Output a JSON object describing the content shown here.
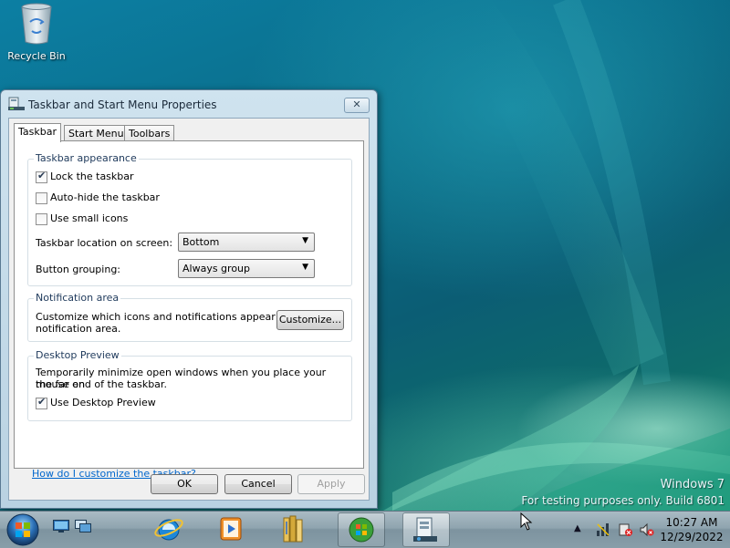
{
  "desktop": {
    "recycle_bin_label": "Recycle Bin",
    "watermark_line1": "Windows 7",
    "watermark_line2": "For testing purposes only. Build 6801"
  },
  "dialog": {
    "title": "Taskbar and Start Menu Properties",
    "close_icon": "close-icon",
    "tabs": [
      {
        "label": "Taskbar",
        "active": true
      },
      {
        "label": "Start Menu",
        "active": false
      },
      {
        "label": "Toolbars",
        "active": false
      }
    ],
    "appearance": {
      "legend": "Taskbar appearance",
      "lock": {
        "label": "Lock the taskbar",
        "checked": true
      },
      "autohide": {
        "label": "Auto-hide the taskbar",
        "checked": false
      },
      "small_icons": {
        "label": "Use small icons",
        "checked": false
      },
      "location_label": "Taskbar location on screen:",
      "location_value": "Bottom",
      "grouping_label": "Button grouping:",
      "grouping_value": "Always group"
    },
    "notification": {
      "legend": "Notification area",
      "text_line1": "Customize which icons and notifications appear in the",
      "text_line2": "notification area.",
      "customize_button": "Customize..."
    },
    "preview": {
      "legend": "Desktop Preview",
      "text_line1": "Temporarily minimize open windows when you place your mouse on",
      "text_line2": "the far end of the taskbar.",
      "use_preview": {
        "label": "Use Desktop Preview",
        "checked": true
      }
    },
    "help_link": "How do I customize the taskbar?",
    "buttons": {
      "ok": "OK",
      "cancel": "Cancel",
      "apply": "Apply"
    }
  },
  "taskbar": {
    "start_icon": "windows-start-orb-icon",
    "pinned": [
      "show-desktop-icon",
      "switch-windows-icon",
      "internet-explorer-icon",
      "media-player-icon",
      "library-folder-icon",
      "windows-orb-task-icon",
      "taskbar-properties-task-icon"
    ],
    "tray": [
      "show-hidden-icons-arrow",
      "network-icon",
      "action-center-icon",
      "volume-muted-icon"
    ],
    "clock_time": "10:27 AM",
    "clock_date": "12/29/2022"
  }
}
